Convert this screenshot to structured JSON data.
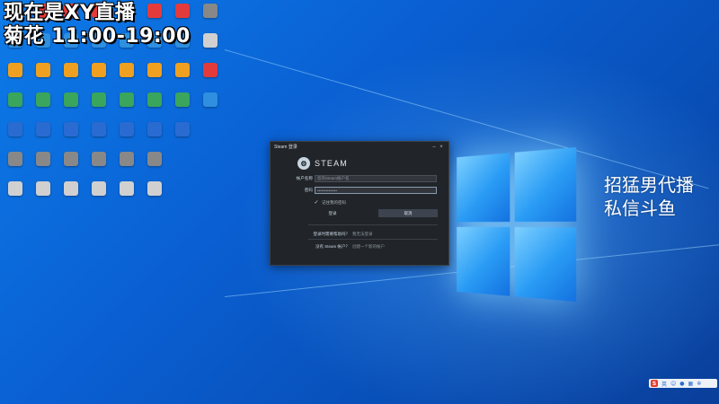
{
  "overlay": {
    "line1": "现在是XY直播",
    "line2": "菊花 11:00-19:00",
    "right_line1": "招猛男代播",
    "right_line2": "私信斗鱼"
  },
  "desktop_icons": [
    {
      "label": "",
      "icon": "app-icon",
      "color": "#e33b3b"
    },
    {
      "label": "",
      "icon": "app-icon",
      "color": "#2f8fe0"
    },
    {
      "label": "",
      "icon": "app-icon",
      "color": "#f0a020"
    },
    {
      "label": "",
      "icon": "app-icon",
      "color": "#3aa55c"
    },
    {
      "label": "",
      "icon": "app-icon",
      "color": "#2a6bd1"
    },
    {
      "label": "",
      "icon": "app-icon",
      "color": "#888888"
    },
    {
      "label": "",
      "icon": "app-icon",
      "color": "#d0d0d0"
    }
  ],
  "steam_dialog": {
    "title": "Steam 登录",
    "brand": "STEAM",
    "account_label": "帐户名称",
    "account_placeholder": "您的Steam帐户名",
    "password_label": "密码",
    "password_value": "••••••••••••••",
    "remember_label": "记住我的密码",
    "login_button": "登录",
    "cancel_button": "取消",
    "help_question": "登录时需要帮助吗？",
    "help_answer": "我无法登录",
    "no_account_question": "没有 Steam 帐户？",
    "no_account_answer": "创建一个新的帐户"
  },
  "taskbar": {
    "ime": "S",
    "ime_mode": "英"
  }
}
